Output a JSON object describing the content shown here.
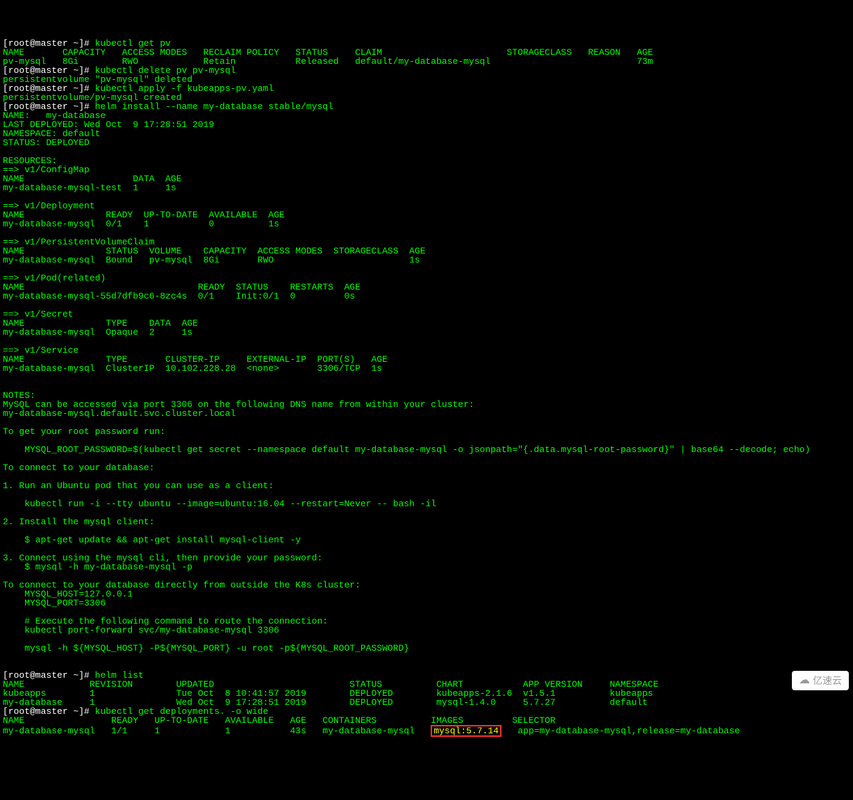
{
  "terminal": {
    "lines": [
      {
        "type": "prompt",
        "prefix": "[root@master ~]# ",
        "cmd": "kubectl get pv"
      },
      {
        "type": "out",
        "text": "NAME       CAPACITY   ACCESS MODES   RECLAIM POLICY   STATUS     CLAIM                       STORAGECLASS   REASON   AGE"
      },
      {
        "type": "out",
        "text": "pv-mysql   8Gi        RWO            Retain           Released   default/my-database-mysql                           73m"
      },
      {
        "type": "prompt",
        "prefix": "[root@master ~]# ",
        "cmd": "kubectl delete pv pv-mysql"
      },
      {
        "type": "out",
        "text": "persistentvolume \"pv-mysql\" deleted"
      },
      {
        "type": "prompt",
        "prefix": "[root@master ~]# ",
        "cmd": "kubectl apply -f kubeapps-pv.yaml"
      },
      {
        "type": "out",
        "text": "persistentvolume/pv-mysql created"
      },
      {
        "type": "prompt",
        "prefix": "[root@master ~]# ",
        "cmd": "helm install --name my-database stable/mysql"
      },
      {
        "type": "out",
        "text": "NAME:   my-database"
      },
      {
        "type": "out",
        "text": "LAST DEPLOYED: Wed Oct  9 17:28:51 2019"
      },
      {
        "type": "out",
        "text": "NAMESPACE: default"
      },
      {
        "type": "out",
        "text": "STATUS: DEPLOYED"
      },
      {
        "type": "out",
        "text": ""
      },
      {
        "type": "out",
        "text": "RESOURCES:"
      },
      {
        "type": "out",
        "text": "==> v1/ConfigMap"
      },
      {
        "type": "out",
        "text": "NAME                    DATA  AGE"
      },
      {
        "type": "out",
        "text": "my-database-mysql-test  1     1s"
      },
      {
        "type": "out",
        "text": ""
      },
      {
        "type": "out",
        "text": "==> v1/Deployment"
      },
      {
        "type": "out",
        "text": "NAME               READY  UP-TO-DATE  AVAILABLE  AGE"
      },
      {
        "type": "out",
        "text": "my-database-mysql  0/1    1           0          1s"
      },
      {
        "type": "out",
        "text": ""
      },
      {
        "type": "out",
        "text": "==> v1/PersistentVolumeClaim"
      },
      {
        "type": "out",
        "text": "NAME               STATUS  VOLUME    CAPACITY  ACCESS MODES  STORAGECLASS  AGE"
      },
      {
        "type": "out",
        "text": "my-database-mysql  Bound   pv-mysql  8Gi       RWO                         1s"
      },
      {
        "type": "out",
        "text": ""
      },
      {
        "type": "out",
        "text": "==> v1/Pod(related)"
      },
      {
        "type": "out",
        "text": "NAME                                READY  STATUS    RESTARTS  AGE"
      },
      {
        "type": "out",
        "text": "my-database-mysql-55d7dfb9c6-8zc4s  0/1    Init:0/1  0         0s"
      },
      {
        "type": "out",
        "text": ""
      },
      {
        "type": "out",
        "text": "==> v1/Secret"
      },
      {
        "type": "out",
        "text": "NAME               TYPE    DATA  AGE"
      },
      {
        "type": "out",
        "text": "my-database-mysql  Opaque  2     1s"
      },
      {
        "type": "out",
        "text": ""
      },
      {
        "type": "out",
        "text": "==> v1/Service"
      },
      {
        "type": "out",
        "text": "NAME               TYPE       CLUSTER-IP     EXTERNAL-IP  PORT(S)   AGE"
      },
      {
        "type": "out",
        "text": "my-database-mysql  ClusterIP  10.102.228.28  <none>       3306/TCP  1s"
      },
      {
        "type": "out",
        "text": ""
      },
      {
        "type": "out",
        "text": ""
      },
      {
        "type": "out",
        "text": "NOTES:"
      },
      {
        "type": "out",
        "text": "MySQL can be accessed via port 3306 on the following DNS name from within your cluster:"
      },
      {
        "type": "out",
        "text": "my-database-mysql.default.svc.cluster.local"
      },
      {
        "type": "out",
        "text": ""
      },
      {
        "type": "out",
        "text": "To get your root password run:"
      },
      {
        "type": "out",
        "text": ""
      },
      {
        "type": "out",
        "text": "    MYSQL_ROOT_PASSWORD=$(kubectl get secret --namespace default my-database-mysql -o jsonpath=\"{.data.mysql-root-password}\" | base64 --decode; echo)"
      },
      {
        "type": "out",
        "text": ""
      },
      {
        "type": "out",
        "text": "To connect to your database:"
      },
      {
        "type": "out",
        "text": ""
      },
      {
        "type": "out",
        "text": "1. Run an Ubuntu pod that you can use as a client:"
      },
      {
        "type": "out",
        "text": ""
      },
      {
        "type": "out",
        "text": "    kubectl run -i --tty ubuntu --image=ubuntu:16.04 --restart=Never -- bash -il"
      },
      {
        "type": "out",
        "text": ""
      },
      {
        "type": "out",
        "text": "2. Install the mysql client:"
      },
      {
        "type": "out",
        "text": ""
      },
      {
        "type": "out",
        "text": "    $ apt-get update && apt-get install mysql-client -y"
      },
      {
        "type": "out",
        "text": ""
      },
      {
        "type": "out",
        "text": "3. Connect using the mysql cli, then provide your password:"
      },
      {
        "type": "out",
        "text": "    $ mysql -h my-database-mysql -p"
      },
      {
        "type": "out",
        "text": ""
      },
      {
        "type": "out",
        "text": "To connect to your database directly from outside the K8s cluster:"
      },
      {
        "type": "out",
        "text": "    MYSQL_HOST=127.0.0.1"
      },
      {
        "type": "out",
        "text": "    MYSQL_PORT=3306"
      },
      {
        "type": "out",
        "text": ""
      },
      {
        "type": "out",
        "text": "    # Execute the following command to route the connection:"
      },
      {
        "type": "out",
        "text": "    kubectl port-forward svc/my-database-mysql 3306"
      },
      {
        "type": "out",
        "text": ""
      },
      {
        "type": "out",
        "text": "    mysql -h ${MYSQL_HOST} -P${MYSQL_PORT} -u root -p${MYSQL_ROOT_PASSWORD}"
      },
      {
        "type": "out",
        "text": "    "
      },
      {
        "type": "out",
        "text": ""
      },
      {
        "type": "prompt",
        "prefix": "[root@master ~]# ",
        "cmd": "helm list"
      },
      {
        "type": "out",
        "text": "NAME            REVISION        UPDATED                         STATUS          CHART           APP VERSION     NAMESPACE"
      },
      {
        "type": "out",
        "text": "kubeapps        1               Tue Oct  8 10:41:57 2019        DEPLOYED        kubeapps-2.1.6  v1.5.1          kubeapps "
      },
      {
        "type": "out",
        "text": "my-database     1               Wed Oct  9 17:28:51 2019        DEPLOYED        mysql-1.4.0     5.7.27          default  "
      },
      {
        "type": "prompt",
        "prefix": "[root@master ~]# ",
        "cmd": "kubectl get deployments. -o wide"
      },
      {
        "type": "out",
        "text": "NAME                READY   UP-TO-DATE   AVAILABLE   AGE   CONTAINERS          IMAGES         SELECTOR"
      },
      {
        "type": "deploy",
        "pre": "my-database-mysql   1/1     1            1           43s   my-database-mysql   ",
        "hl": "mysql:5.7.14",
        "post": "   app=my-database-mysql,release=my-database"
      }
    ]
  },
  "watermark": {
    "text": "亿速云"
  }
}
